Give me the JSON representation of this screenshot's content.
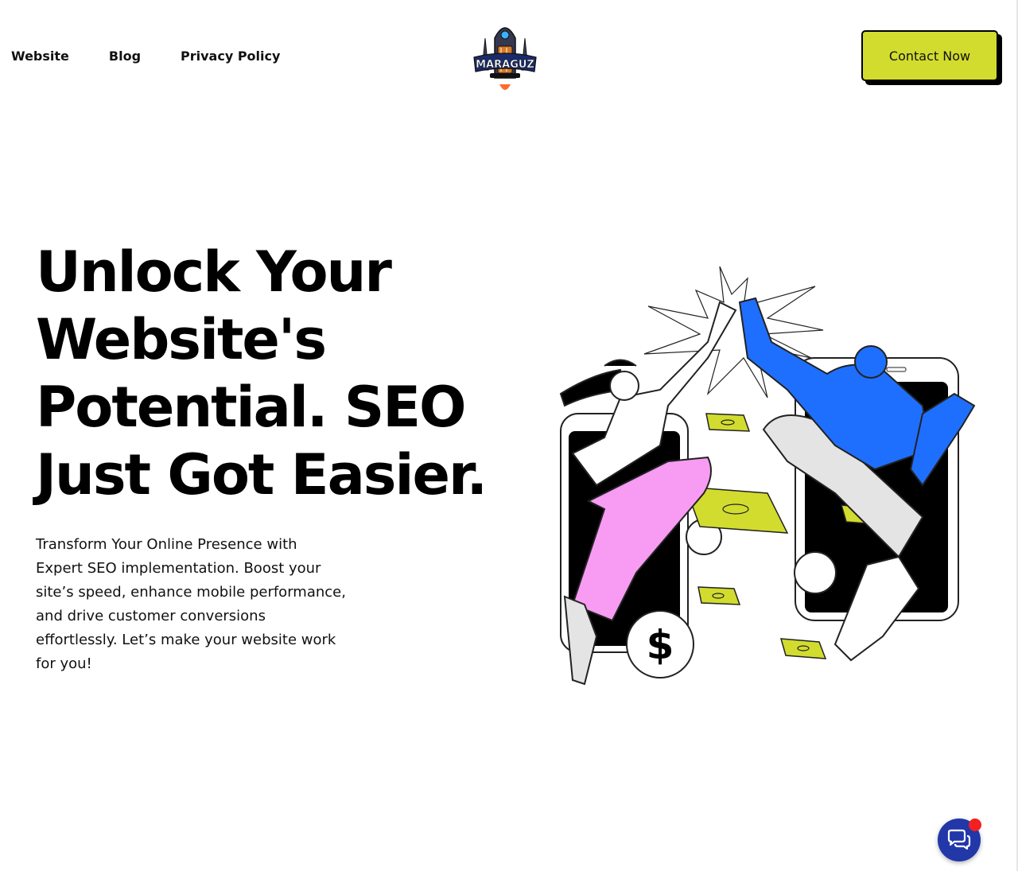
{
  "nav": {
    "items": [
      {
        "label": "Website"
      },
      {
        "label": "Blog"
      },
      {
        "label": "Privacy Policy"
      }
    ]
  },
  "logo": {
    "text": "MARAGUZ",
    "icon": "rocket-logo-icon"
  },
  "header": {
    "cta_label": "Contact Now"
  },
  "hero": {
    "title": "Unlock Your Website's Potential. SEO Just Got Easier.",
    "subtitle": "Transform Your Online Presence with Expert SEO implementation. Boost your site’s speed, enhance mobile performance, and drive customer conversions effortlessly. Let’s make your website work for you!"
  },
  "chat": {
    "icon": "chat-bubbles-icon"
  },
  "colors": {
    "accent": "#d2dc2e",
    "chat": "#2237a8",
    "notification": "#f22020",
    "illustration_blue": "#1f6fff",
    "illustration_pink": "#f79cf2",
    "illustration_gray": "#e4e4e4"
  }
}
